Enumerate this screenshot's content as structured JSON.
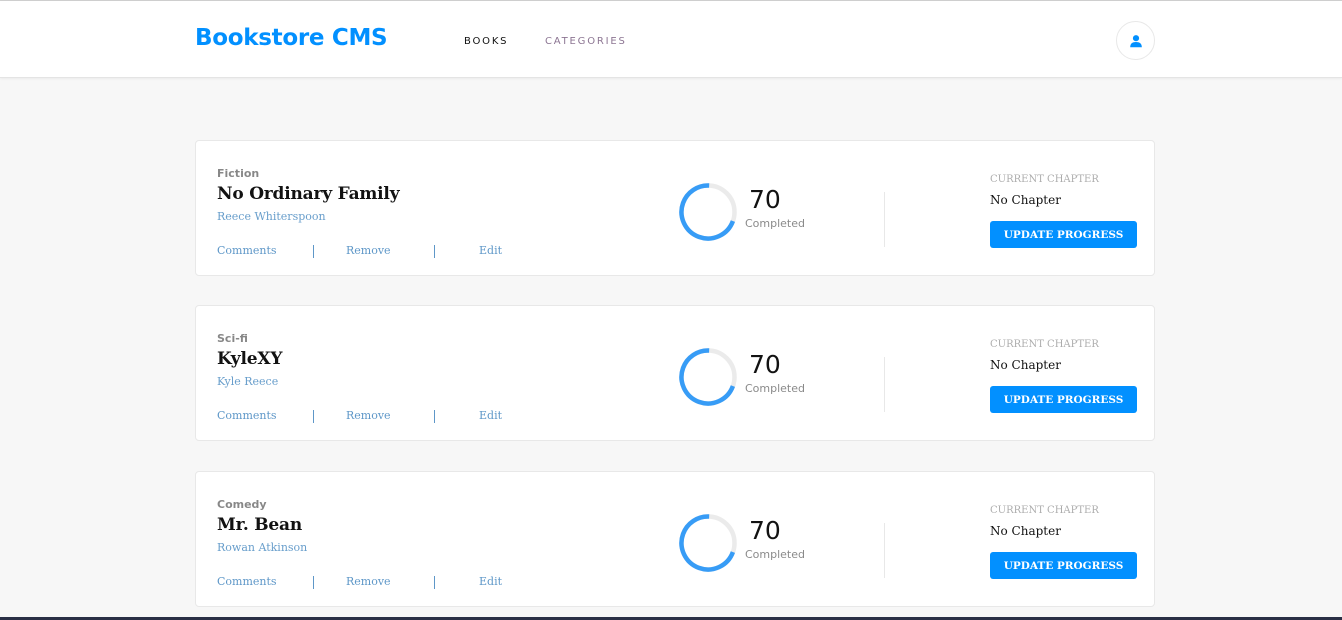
{
  "header": {
    "brand": "Bookstore CMS",
    "nav": [
      {
        "label": "BOOKS"
      },
      {
        "label": "CATEGORIES"
      }
    ],
    "user_icon": "user-icon"
  },
  "progress_label": "Completed",
  "current_chapter_label": "CURRENT CHAPTER",
  "update_button_label": "UPDATE PROGRESS",
  "actions": {
    "comments": "Comments",
    "remove": "Remove",
    "edit": "Edit"
  },
  "books": [
    {
      "category": "Fiction",
      "title": "No Ordinary Family",
      "author": "Reece Whiterspoon",
      "progress": 70,
      "chapter": "No Chapter"
    },
    {
      "category": "Sci-fi",
      "title": "KyleXY",
      "author": "Kyle Reece",
      "progress": 70,
      "chapter": "No Chapter"
    },
    {
      "category": "Comedy",
      "title": "Mr. Bean",
      "author": "Rowan Atkinson",
      "progress": 70,
      "chapter": "No Chapter"
    }
  ],
  "colors": {
    "accent": "#0290ff",
    "progress_ring": "#379cf6",
    "ring_track": "#ebebeb"
  }
}
